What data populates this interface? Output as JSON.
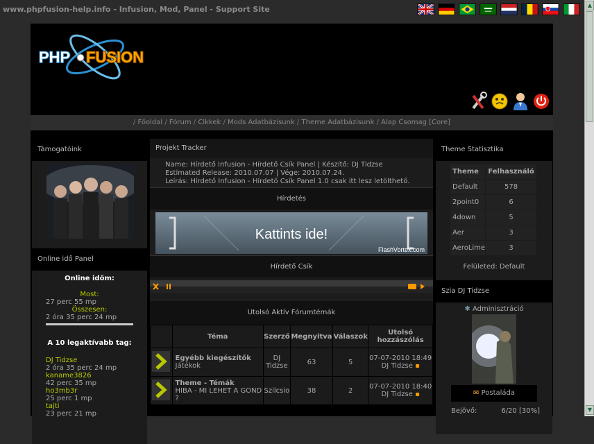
{
  "site_title": "www.phpfusion-help.info - Infusion, Mod, Panel - Support Site",
  "flags": [
    "uk-flag",
    "german-flag",
    "brazil-flag",
    "saudi-flag",
    "dutch-flag",
    "romanian-flag",
    "slovak-flag",
    "italian-flag"
  ],
  "logo_text": {
    "left": "PHP",
    "right": "FUSION"
  },
  "nav": [
    "Főoldal",
    "Fórum",
    "Cikkek",
    "Mods Adatbázisunk",
    "Theme Adatbázisunk",
    "Alap Csomag [Core]"
  ],
  "left": {
    "sponsors_title": "Támogatóink",
    "online_title": "Online idő Panel",
    "my_online": "Online időm:",
    "now_label": "Most:",
    "now_value": "27 perc 55 mp",
    "total_label": "Összesen:",
    "total_value": "2 óra 35 perc 24 mp",
    "top_title": "A 10 legaktívabb tag:",
    "top_users": [
      {
        "name": "DJ Tidzse",
        "time": "2 óra 35 perc 24 mp"
      },
      {
        "name": "kaname3826",
        "time": "42 perc 35 mp"
      },
      {
        "name": "ho3mb3r",
        "time": "25 perc 1 mp"
      },
      {
        "name": "tajti",
        "time": "23 perc 21 mp"
      }
    ]
  },
  "center": {
    "tracker_title": "Projekt Tracker",
    "tracker_line1": "Name: Hírdető Infusion - Hírdető Csík Panel | Készítő: DJ Tidzse",
    "tracker_line2": "Estimated Release: 2010.07.07 | Vége: 2010.07.24.",
    "tracker_line3": "Leírás: Hírdető Infusion - Hírdető Csík Panel 1.0 csak itt lesz letölthető.",
    "ad_title": "Hírdetés",
    "banner_text": "Kattints ide!",
    "banner_credit": "FlashVortex.com",
    "strip_title": "Hírdető Csík",
    "forum_title": "Utolsó Aktív Fórumtémák",
    "columns": [
      "Téma",
      "Szerző",
      "Megnyitva",
      "Válaszok",
      "Utolsó hozzászólás"
    ],
    "rows": [
      {
        "topic": "Egyébb kiegészítők",
        "sub": "Játékok",
        "author": "DJ Tidzse",
        "views": "63",
        "replies": "5",
        "last_date": "07-07-2010 18:49",
        "last_user": "DJ Tidzse"
      },
      {
        "topic": "Theme - Témák",
        "sub": "HIBA - MI LEHET A GOND ?",
        "author": "Szilcsio",
        "views": "38",
        "replies": "2",
        "last_date": "07-07-2010 18:40",
        "last_user": "DJ Tidzse"
      }
    ]
  },
  "right": {
    "stats_title": "Theme Statisztika",
    "stats_headers": [
      "Theme",
      "Felhasználó"
    ],
    "stats_rows": [
      {
        "name": "Default",
        "users": "578"
      },
      {
        "name": "2point0",
        "users": "6"
      },
      {
        "name": "4down",
        "users": "5"
      },
      {
        "name": "Aer",
        "users": "3"
      },
      {
        "name": "AeroLime",
        "users": "3"
      }
    ],
    "your_theme": "Felületed: Default",
    "user_title": "Szia DJ Tidzse",
    "admin_link": "Adminisztráció",
    "mailbox": "Postaláda",
    "inbox_label": "Bejövő:",
    "inbox_value": "6/20 [30%]"
  }
}
